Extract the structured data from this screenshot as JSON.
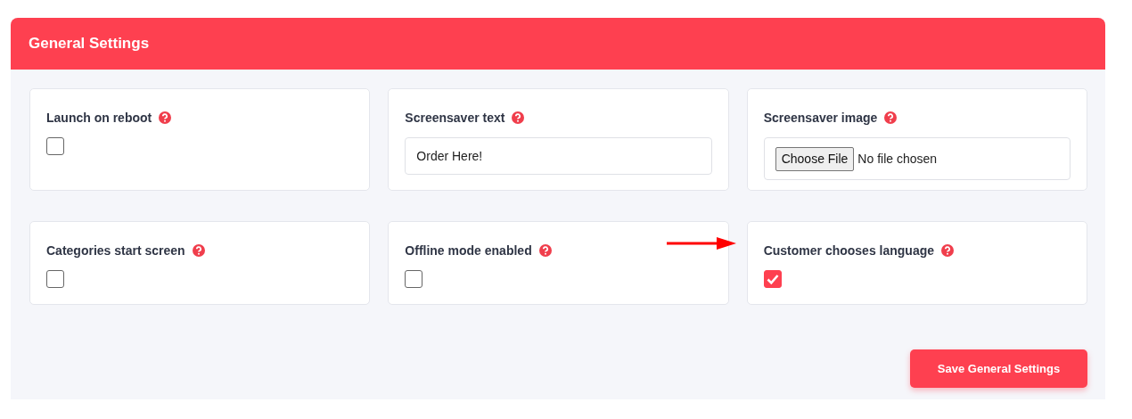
{
  "panel": {
    "title": "General Settings"
  },
  "settings": [
    {
      "kind": "checkbox",
      "label": "Launch on reboot",
      "checked": false
    },
    {
      "kind": "text",
      "label": "Screensaver text",
      "value": "Order Here!"
    },
    {
      "kind": "file",
      "label": "Screensaver image",
      "button": "Choose File",
      "status": "No file chosen"
    },
    {
      "kind": "checkbox",
      "label": "Categories start screen",
      "checked": false
    },
    {
      "kind": "checkbox",
      "label": "Offline mode enabled",
      "checked": false
    },
    {
      "kind": "checkbox",
      "label": "Customer chooses language",
      "checked": true
    }
  ],
  "save_button": "Save General Settings"
}
